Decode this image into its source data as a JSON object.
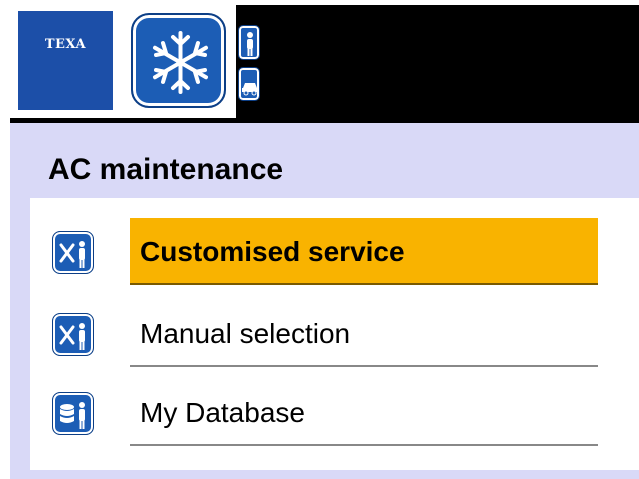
{
  "brand": {
    "logo_text": "TEXA",
    "logo_color": "#1c4fa8"
  },
  "header": {
    "main_icon": "snowflake-icon",
    "side_icons": [
      "person-icon",
      "car-icon"
    ]
  },
  "page": {
    "title": "AC maintenance"
  },
  "menu": {
    "selected_index": 0,
    "items": [
      {
        "label": "Customised service",
        "icon": "tools-person-icon"
      },
      {
        "label": "Manual selection",
        "icon": "tools-person-icon"
      },
      {
        "label": "My Database",
        "icon": "database-person-icon"
      }
    ]
  },
  "colors": {
    "panel_background": "#d9d9f7",
    "selected_highlight": "#f9b300",
    "icon_blue": "#1c5db5",
    "header_background": "#000000"
  }
}
